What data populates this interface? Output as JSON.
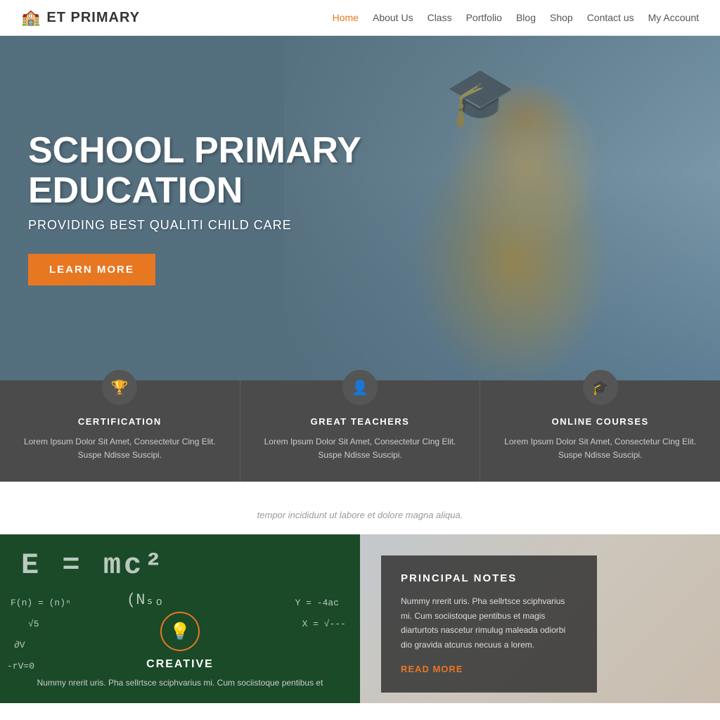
{
  "header": {
    "logo_icon": "🏫",
    "logo_text": "ET PRIMARY",
    "nav_items": [
      {
        "label": "Home",
        "active": true
      },
      {
        "label": "About Us",
        "active": false
      },
      {
        "label": "Class",
        "active": false
      },
      {
        "label": "Portfolio",
        "active": false
      },
      {
        "label": "Blog",
        "active": false
      },
      {
        "label": "Shop",
        "active": false
      },
      {
        "label": "Contact us",
        "active": false
      },
      {
        "label": "My Account",
        "active": false
      }
    ]
  },
  "hero": {
    "title_line1": "SCHOOL PRIMARY",
    "title_line2": "EDUCATION",
    "subtitle": "PROVIDING BEST QUALITI CHILD CARE",
    "button_label": "LEARN MORE"
  },
  "features": [
    {
      "icon": "🏆",
      "title": "CERTIFICATION",
      "desc": "Lorem Ipsum Dolor Sit Amet, Consectetur Cing Elit. Suspe Ndisse Suscipi."
    },
    {
      "icon": "👤",
      "title": "GREAT TEACHERS",
      "desc": "Lorem Ipsum Dolor Sit Amet, Consectetur Cing Elit. Suspe Ndisse Suscipi."
    },
    {
      "icon": "🎓",
      "title": "ONLINE COURSES",
      "desc": "Lorem Ipsum Dolor Sit Amet, Consectetur Cing Elit. Suspe Ndisse Suscipi."
    }
  ],
  "middle": {
    "subtitle": "tempor incididunt ut labore et dolore magna aliqua."
  },
  "panel_left": {
    "icon": "💡",
    "title": "CREATIVE",
    "desc": "Nummy nrerit uris. Pha sellrtsce sciphvarius mi. Cum sociistoque pentibus et"
  },
  "panel_right": {
    "title": "PRINCIPAL NOTES",
    "desc": "Nummy nrerit uris. Pha sellrtsce sciphvarius mi. Cum sociistoque pentibus et magis diarturtots nascetur rimulug maleada odiorbi dio gravida atcurus necuus a lorem.",
    "read_more": "READ MORE"
  },
  "chalkboard": {
    "formula_big": "E = mc²",
    "formula_1": "F(n) = (n)ⁿ",
    "formula_2": "    √5",
    "formula_3": "∂V",
    "formula_4": "-rV=0",
    "formula_5": "Y = -4ac",
    "formula_6": "X = √---",
    "formula_7": "(Nₛₒ"
  }
}
